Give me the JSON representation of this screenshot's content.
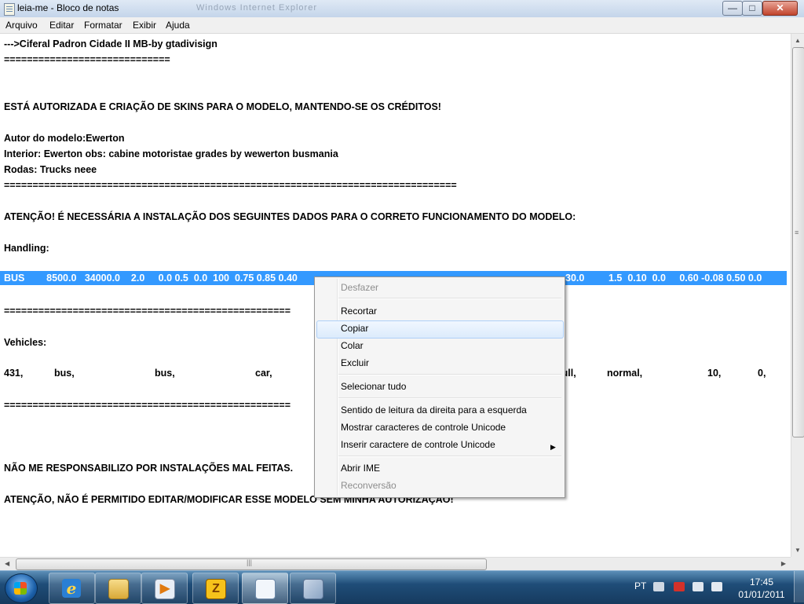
{
  "window": {
    "title": "leia-me - Bloco de notas",
    "ghost_title": "Windows Internet Explorer",
    "controls": {
      "minimize": "—",
      "maximize": "□",
      "close": "✕"
    }
  },
  "menu": [
    "Arquivo",
    "Editar",
    "Formatar",
    "Exibir",
    "Ajuda"
  ],
  "editor": {
    "lines": [
      "--->Ciferal Padron Cidade II MB-by gtadivisign",
      "=============================",
      "ESTÁ AUTORIZADA E CRIAÇÃO DE SKINS PARA O MODELO, MANTENDO-SE OS CRÉDITOS!",
      "Autor do modelo:Ewerton",
      "Interior: Ewerton obs: cabine motoristae grades by wewerton busmania",
      "Rodas: Trucks neee",
      "===============================================================================",
      "ATENÇÃO! É NECESSÁRIA A INSTALAÇÃO DOS SEGUINTES DADOS PARA O CORRETO FUNCIONAMENTO DO MODELO:",
      "Handling:",
      "==================================================",
      "Vehicles:",
      "==================================================",
      "NÃO ME RESPONSABILIZO POR INSTALAÇÕES MAL FEITAS.",
      "ATENÇÃO, NÃO É PERMITIDO EDITAR/MODIFICAR ESSE MODELO SEM MINHA AUTORIZAÇÃO!"
    ],
    "selected_line_left": "BUS        8500.0   34000.0    2.0     0.0 0.5  0.0  100  0.75 0.85 0.40",
    "selected_line_right": "1.5  0.10  0.0     0.60 -0.08 0.50 0.0",
    "selected_line_mid": "30.0",
    "vehicles_row": [
      "431,",
      "bus,",
      "bus,",
      "car,",
      "null,",
      "normal,",
      "10,",
      "0,"
    ]
  },
  "context_menu": {
    "items": [
      {
        "label": "Desfazer",
        "enabled": false
      },
      {
        "label": "Recortar",
        "enabled": true
      },
      {
        "label": "Copiar",
        "enabled": true,
        "highlighted": true
      },
      {
        "label": "Colar",
        "enabled": true
      },
      {
        "label": "Excluir",
        "enabled": true
      },
      {
        "label": "Selecionar tudo",
        "enabled": true
      },
      {
        "label": "Sentido de leitura da direita para a esquerda",
        "enabled": true
      },
      {
        "label": "Mostrar caracteres de controle Unicode",
        "enabled": true
      },
      {
        "label": "Inserir caractere de controle Unicode",
        "enabled": true,
        "submenu": true
      },
      {
        "label": "Abrir IME",
        "enabled": true
      },
      {
        "label": "Reconversão",
        "enabled": false
      }
    ],
    "submenu_arrow": "▶"
  },
  "scrollbars": {
    "up": "▲",
    "down": "▼",
    "left": "◀",
    "right": "▶",
    "grip": "≡",
    "hgrip": "|||"
  },
  "taskbar": {
    "apps": [
      "internet-explorer",
      "windows-explorer",
      "media-player",
      "winzip",
      "notepad",
      "paint-tools"
    ],
    "app_glyphs": [
      "e",
      "",
      "▶",
      "Z",
      "",
      ""
    ],
    "language": "PT",
    "time": "17:45",
    "date": "01/01/2011"
  },
  "colors": {
    "selection": "#3399ff",
    "menu_highlight": "#dcebfc",
    "taskbar": "#1f4d78"
  }
}
